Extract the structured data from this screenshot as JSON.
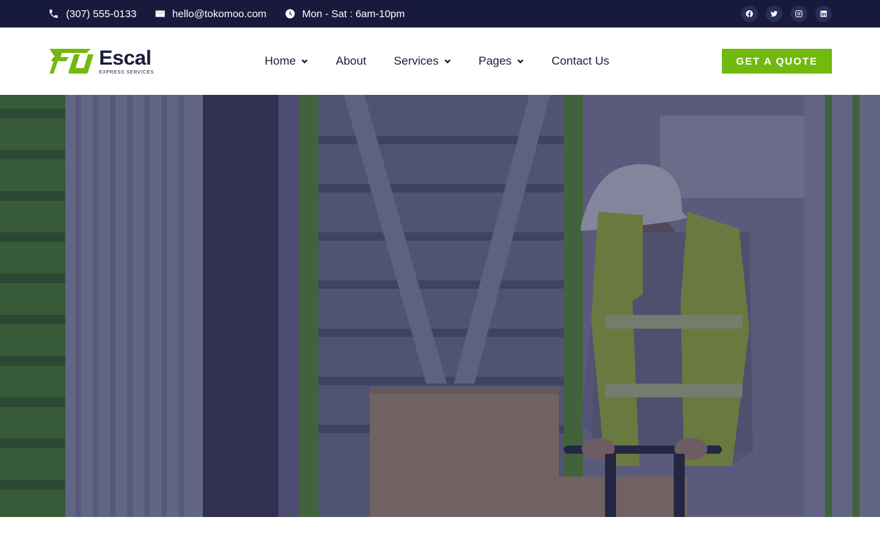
{
  "topbar": {
    "phone": "(307) 555-0133",
    "email": "hello@tokomoo.com",
    "hours": "Mon - Sat : 6am-10pm",
    "socials": [
      {
        "icon": "facebook-icon"
      },
      {
        "icon": "twitter-icon"
      },
      {
        "icon": "instagram-icon"
      },
      {
        "icon": "linkedin-icon"
      }
    ]
  },
  "header": {
    "logo": {
      "brand": "Escal",
      "tagline": "EXPRESS SERVICES"
    },
    "nav": [
      {
        "label": "Home",
        "dropdown": true
      },
      {
        "label": "About",
        "dropdown": false
      },
      {
        "label": "Services",
        "dropdown": true
      },
      {
        "label": "Pages",
        "dropdown": true
      },
      {
        "label": "Contact Us",
        "dropdown": false
      }
    ],
    "cta_label": "GET A QUOTE"
  },
  "colors": {
    "topbar_bg": "#181a3d",
    "accent": "#72b90f",
    "text_dark": "#1b1d3d",
    "hero_overlay": "#1e2048"
  }
}
